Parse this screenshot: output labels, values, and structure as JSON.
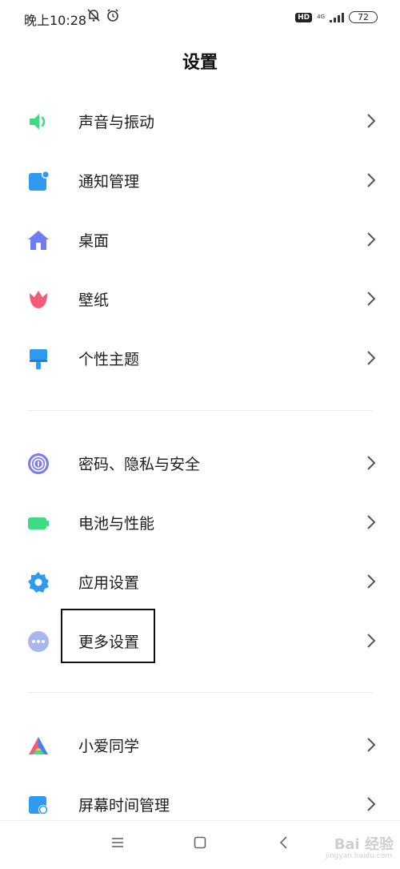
{
  "status_bar": {
    "time": "晚上10:28",
    "hd_badge": "HD",
    "network": "4G",
    "battery": "72"
  },
  "header": {
    "title": "设置"
  },
  "groups": [
    {
      "items": [
        {
          "label": "声音与振动",
          "icon": "speaker-icon",
          "color": "#3ddc84"
        },
        {
          "label": "通知管理",
          "icon": "notification-icon",
          "color": "#2e9bf0"
        },
        {
          "label": "桌面",
          "icon": "home-icon",
          "color": "#6f7cf7"
        },
        {
          "label": "壁纸",
          "icon": "tulip-icon",
          "color": "#f25c7a"
        },
        {
          "label": "个性主题",
          "icon": "brush-icon",
          "color": "#2e9bf0"
        }
      ]
    },
    {
      "items": [
        {
          "label": "密码、隐私与安全",
          "icon": "fingerprint-icon",
          "color": "#7a7cf0"
        },
        {
          "label": "电池与性能",
          "icon": "battery-icon",
          "color": "#3ddc84"
        },
        {
          "label": "应用设置",
          "icon": "gear-icon",
          "color": "#2e9bf0"
        },
        {
          "label": "更多设置",
          "icon": "more-icon",
          "color": "#9fb0e8"
        }
      ]
    },
    {
      "items": [
        {
          "label": "小爱同学",
          "icon": "xiaoai-icon",
          "color": "#4a7cf5"
        },
        {
          "label": "屏幕时间管理",
          "icon": "screen-time-icon",
          "color": "#2e9bf0"
        }
      ]
    }
  ],
  "watermark": {
    "text": "Bai 经验",
    "sub": "jingyan.baidu.com"
  }
}
